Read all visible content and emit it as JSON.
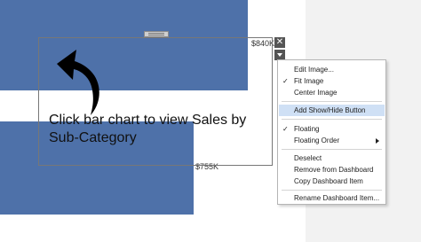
{
  "canvas": {
    "bar_top_value": "$840K",
    "bar_bottom_value": "$755K"
  },
  "floating_item": {
    "text": "Click bar chart to view Sales by Sub-Category",
    "close_glyph": "✕",
    "arrow_icon": "curved-arrow-icon"
  },
  "context_menu": {
    "items": [
      {
        "label": "Edit Image...",
        "checked": false
      },
      {
        "label": "Fit Image",
        "checked": true
      },
      {
        "label": "Center Image",
        "checked": false
      },
      {
        "label": "Add Show/Hide Button",
        "checked": false,
        "highlighted": true
      },
      {
        "label": "Floating",
        "checked": true
      },
      {
        "label": "Floating Order",
        "checked": false,
        "submenu": true
      },
      {
        "label": "Deselect",
        "checked": false
      },
      {
        "label": "Remove from Dashboard",
        "checked": false
      },
      {
        "label": "Copy Dashboard Item",
        "checked": false
      },
      {
        "label": "Rename Dashboard Item...",
        "checked": false
      }
    ],
    "check_glyph": "✓"
  },
  "colors": {
    "bar": "#4e71a9",
    "highlight": "#cfe0f5",
    "panel": "#f2f2f2"
  }
}
